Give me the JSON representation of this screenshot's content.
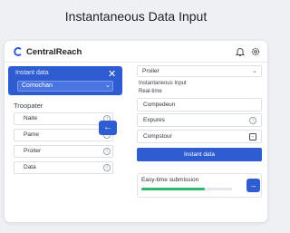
{
  "page": {
    "title": "Instantaneous Data Input"
  },
  "app": {
    "brand": "CentralReach",
    "brand_color": "#2f5dd1",
    "icons": [
      "bell-icon",
      "gear-icon"
    ]
  },
  "left_panel": {
    "header_title": "Instant data",
    "close_glyph": "✕",
    "select_value": "Comochan",
    "section_label": "Troopater",
    "items": [
      {
        "label": "Naite",
        "icon": "info-icon"
      },
      {
        "label": "Pame",
        "icon": "info-icon"
      },
      {
        "label": "Proiter",
        "icon": "info-icon"
      },
      {
        "label": "Data",
        "icon": "info-icon"
      }
    ],
    "move_glyph": "←"
  },
  "right_panel": {
    "select_value": "Proiler",
    "label_1": "Instantaneous Input",
    "label_2": "Real-time",
    "field_1": "Compedeun",
    "field_2": "Expures",
    "field_3": "Compstour",
    "button_label": "Instant data",
    "submission": {
      "label": "Easy-time submission",
      "progress_percent": 70,
      "progress_color": "#2eb86a",
      "arrow_glyph": "→"
    }
  }
}
